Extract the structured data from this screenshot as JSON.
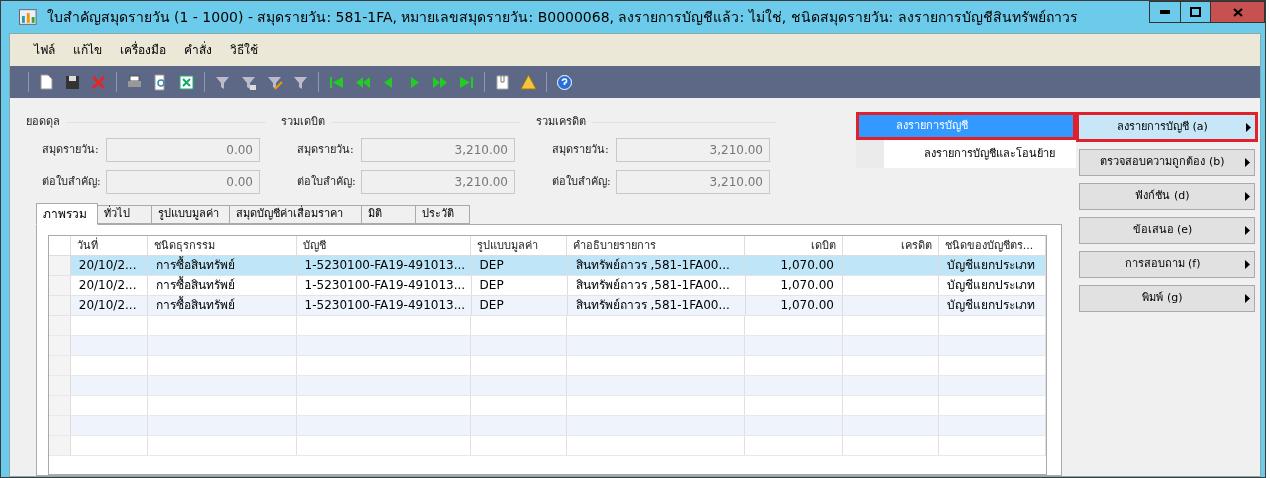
{
  "window": {
    "title": "ใบสำคัญสมุดรายวัน (1 - 1000) - สมุดรายวัน: 581-1FA, หมายเลขสมุดรายวัน: B0000068, ลงรายการบัญชีแล้ว: ไม่ใช่, ชนิดสมุดรายวัน: ลงรายการบัญชีสินทรัพย์ถาวร"
  },
  "menu": [
    "ไฟล์",
    "แก้ไข",
    "เครื่องมือ",
    "คำสั่ง",
    "วิธีใช้"
  ],
  "balance_groups": [
    {
      "title": "ยอดดุล",
      "fields": [
        {
          "label": "สมุดรายวัน:",
          "value": "0.00"
        },
        {
          "label": "ต่อใบสำคัญ:",
          "value": "0.00"
        }
      ]
    },
    {
      "title": "รวมเดบิต",
      "fields": [
        {
          "label": "สมุดรายวัน:",
          "value": "3,210.00"
        },
        {
          "label": "ต่อใบสำคัญ:",
          "value": "3,210.00"
        }
      ]
    },
    {
      "title": "รวมเครดิต",
      "fields": [
        {
          "label": "สมุดรายวัน:",
          "value": "3,210.00"
        },
        {
          "label": "ต่อใบสำคัญ:",
          "value": "3,210.00"
        }
      ]
    }
  ],
  "tabs": [
    {
      "label": "ภาพรวม",
      "selected": true
    },
    {
      "label": "ทั่วไป",
      "selected": false
    },
    {
      "label": "รูปแบบมูลค่า",
      "selected": false
    },
    {
      "label": "สมุดบัญชีค่าเสื่อมราคา",
      "selected": false
    },
    {
      "label": "มิติ",
      "selected": false
    },
    {
      "label": "ประวัติ",
      "selected": false
    }
  ],
  "table": {
    "columns": [
      "วันที่",
      "ชนิดธุรกรรม",
      "บัญชี",
      "รูปแบบมูลค่า",
      "คำอธิบายรายการ",
      "เดบิต",
      "เครดิต",
      "ชนิดของบัญชีตร..."
    ],
    "rows": [
      {
        "selected": true,
        "cells": [
          "20/10/2...",
          "การซื้อสินทรัพย์",
          "1-5230100-FA19-491013...",
          "DEP",
          "สินทรัพย์ถาวร  ,581-1FA00...",
          "1,070.00",
          "",
          "บัญชีแยกประเภท"
        ]
      },
      {
        "selected": false,
        "cells": [
          "20/10/2...",
          "การซื้อสินทรัพย์",
          "1-5230100-FA19-491013...",
          "DEP",
          "สินทรัพย์ถาวร  ,581-1FA00...",
          "1,070.00",
          "",
          "บัญชีแยกประเภท"
        ]
      },
      {
        "selected": false,
        "cells": [
          "20/10/2...",
          "การซื้อสินทรัพย์",
          "1-5230100-FA19-491013...",
          "DEP",
          "สินทรัพย์ถาวร  ,581-1FA00...",
          "1,070.00",
          "",
          "บัญชีแยกประเภท"
        ]
      }
    ]
  },
  "dropdown": {
    "items": [
      {
        "label": "ลงรายการบัญชี",
        "selected": true
      },
      {
        "label": "ลงรายการบัญชีและโอนย้าย",
        "selected": false
      }
    ]
  },
  "buttons": [
    {
      "label": "ลงรายการบัญชี (a)",
      "selected": true
    },
    {
      "label": "ตรวจสอบความถูกต้อง (b)",
      "selected": false
    },
    {
      "label": "ฟังก์ชัน (d)",
      "selected": false
    },
    {
      "label": "ข้อเสนอ (e)",
      "selected": false
    },
    {
      "label": "การสอบถาม (f)",
      "selected": false
    },
    {
      "label": "พิมพ์ (g)",
      "selected": false
    }
  ]
}
